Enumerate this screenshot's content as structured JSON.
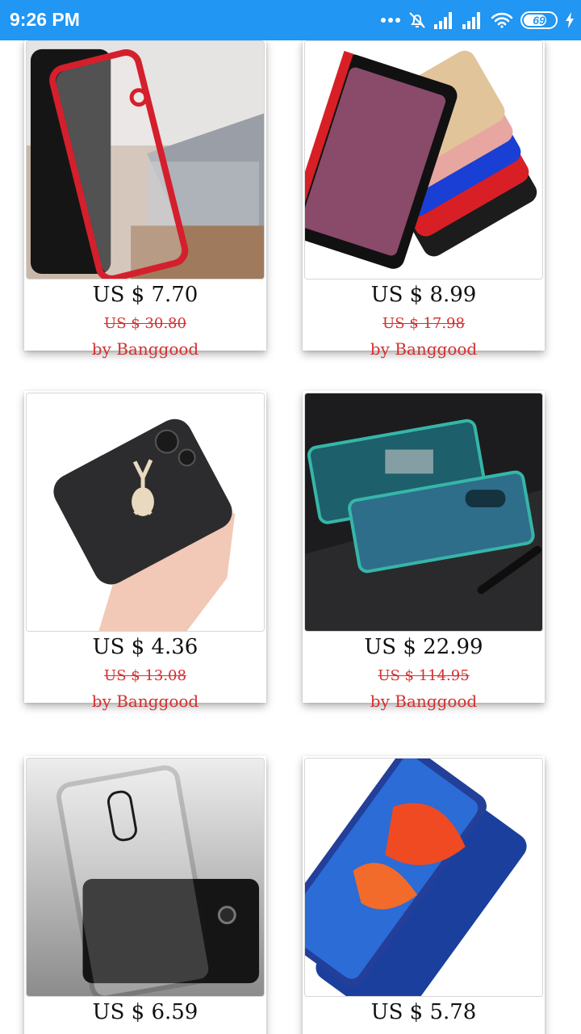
{
  "status_bar": {
    "time": "9:26 PM",
    "battery": "69"
  },
  "products": [
    {
      "price": "US $ 7.70",
      "old_price": "US $ 30.80",
      "seller": "by Banggood",
      "image": "clear-red-bumper-phone-case"
    },
    {
      "price": "US $ 8.99",
      "old_price": "US $ 17.98",
      "seller": "by Banggood",
      "image": "colorful-hard-phone-cases-fan"
    },
    {
      "price": "US $ 4.36",
      "old_price": "US $ 13.08",
      "seller": "by Banggood",
      "image": "black-deer-phone-case-in-hand"
    },
    {
      "price": "US $ 22.99",
      "old_price": "US $ 114.95",
      "seller": "by Banggood",
      "image": "magnetic-glass-phone-case"
    },
    {
      "price": "US $ 6.59",
      "old_price": "",
      "seller": "",
      "image": "clear-black-bumper-phone-case"
    },
    {
      "price": "US $ 5.78",
      "old_price": "",
      "seller": "",
      "image": "blue-slim-phone-case"
    }
  ]
}
